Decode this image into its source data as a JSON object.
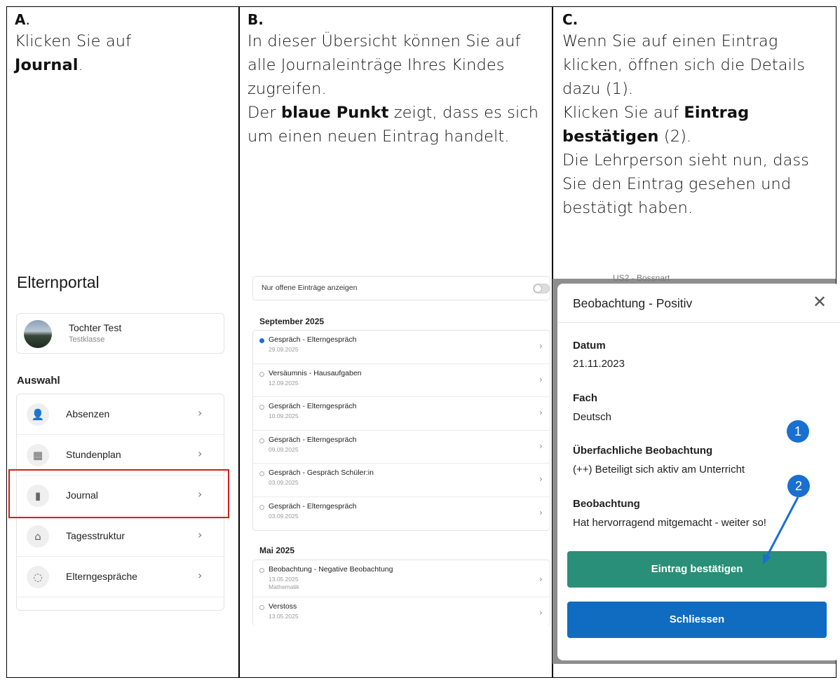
{
  "col_a": {
    "head": "A",
    "head_suffix": ".",
    "text_1": "Klicken Sie auf",
    "text_bold": "Journal",
    "text_2": "."
  },
  "col_b": {
    "head": "B.",
    "text_1": "In dieser Übersicht können Sie auf alle Journaleinträge Ihres Kindes zugreifen.",
    "text_2": "Der ",
    "text_bold": "blaue Punkt",
    "text_3": " zeigt, dass es sich um einen neuen Eintrag handelt."
  },
  "col_c": {
    "head": "C.",
    "text_1": "Wenn Sie auf einen Eintrag klicken, öffnen sich die Details dazu (1).",
    "text_2": "Klicken Sie auf ",
    "text_bold": "Eintrag bestätigen",
    "text_3": " (2).",
    "text_4": "Die Lehrperson sieht nun, dass Sie den Eintrag gesehen und bestätigt haben."
  },
  "portal": {
    "title": "Elternportal",
    "child_name": "Tochter Test",
    "child_class": "Testklasse",
    "section": "Auswahl",
    "items": [
      {
        "label": "Absenzen",
        "icon": "person-absent-icon",
        "glyph": "👤"
      },
      {
        "label": "Stundenplan",
        "icon": "calendar-icon",
        "glyph": "▦"
      },
      {
        "label": "Journal",
        "icon": "journal-icon",
        "glyph": "▮"
      },
      {
        "label": "Tagesstruktur",
        "icon": "home-clock-icon",
        "glyph": "⌂"
      },
      {
        "label": "Elterngespräche",
        "icon": "chat-icon",
        "glyph": "◌"
      }
    ]
  },
  "journal": {
    "toggle_label": "Nur offene Einträge anzeigen",
    "months": [
      {
        "name": "September 2025",
        "entries": [
          {
            "title": "Gespräch - Elterngespräch",
            "date": "29.09.2025",
            "new": true
          },
          {
            "title": "Versäumnis - Hausaufgaben",
            "date": "12.09.2025",
            "new": false
          },
          {
            "title": "Gespräch - Elterngespräch",
            "date": "10.09.2025",
            "new": false
          },
          {
            "title": "Gespräch - Elterngespräch",
            "date": "09.09.2025",
            "new": false
          },
          {
            "title": "Gespräch - Gespräch Schüler:in",
            "date": "03.09.2025",
            "new": false
          },
          {
            "title": "Gespräch - Elterngespräch",
            "date": "03.09.2025",
            "new": false
          }
        ]
      },
      {
        "name": "Mai 2025",
        "entries": [
          {
            "title": "Beobachtung - Negative Beobachtung",
            "date": "13.05.2025",
            "sub": "Mathematik",
            "new": false
          },
          {
            "title": "Verstoss",
            "date": "13.05.2025",
            "new": false
          }
        ]
      }
    ]
  },
  "modal": {
    "behind_text": "US2 - Bossnart",
    "title": "Beobachtung - Positiv",
    "close_glyph": "✕",
    "fields": [
      {
        "label": "Datum",
        "value": "21.11.2023"
      },
      {
        "label": "Fach",
        "value": "Deutsch"
      },
      {
        "label": "Überfachliche Beobachtung",
        "value": "(++) Beteiligt sich aktiv am Unterricht"
      },
      {
        "label": "Beobachtung",
        "value": "Hat hervorragend mitgemacht - weiter so!"
      }
    ],
    "confirm_label": "Eintrag bestätigen",
    "close_label": "Schliessen",
    "badge_1": "1",
    "badge_2": "2"
  },
  "colors": {
    "new_dot": "#1a6fd0",
    "confirm_button": "#2a8f78",
    "close_button": "#106cc0",
    "highlight": "#d71d1d"
  }
}
